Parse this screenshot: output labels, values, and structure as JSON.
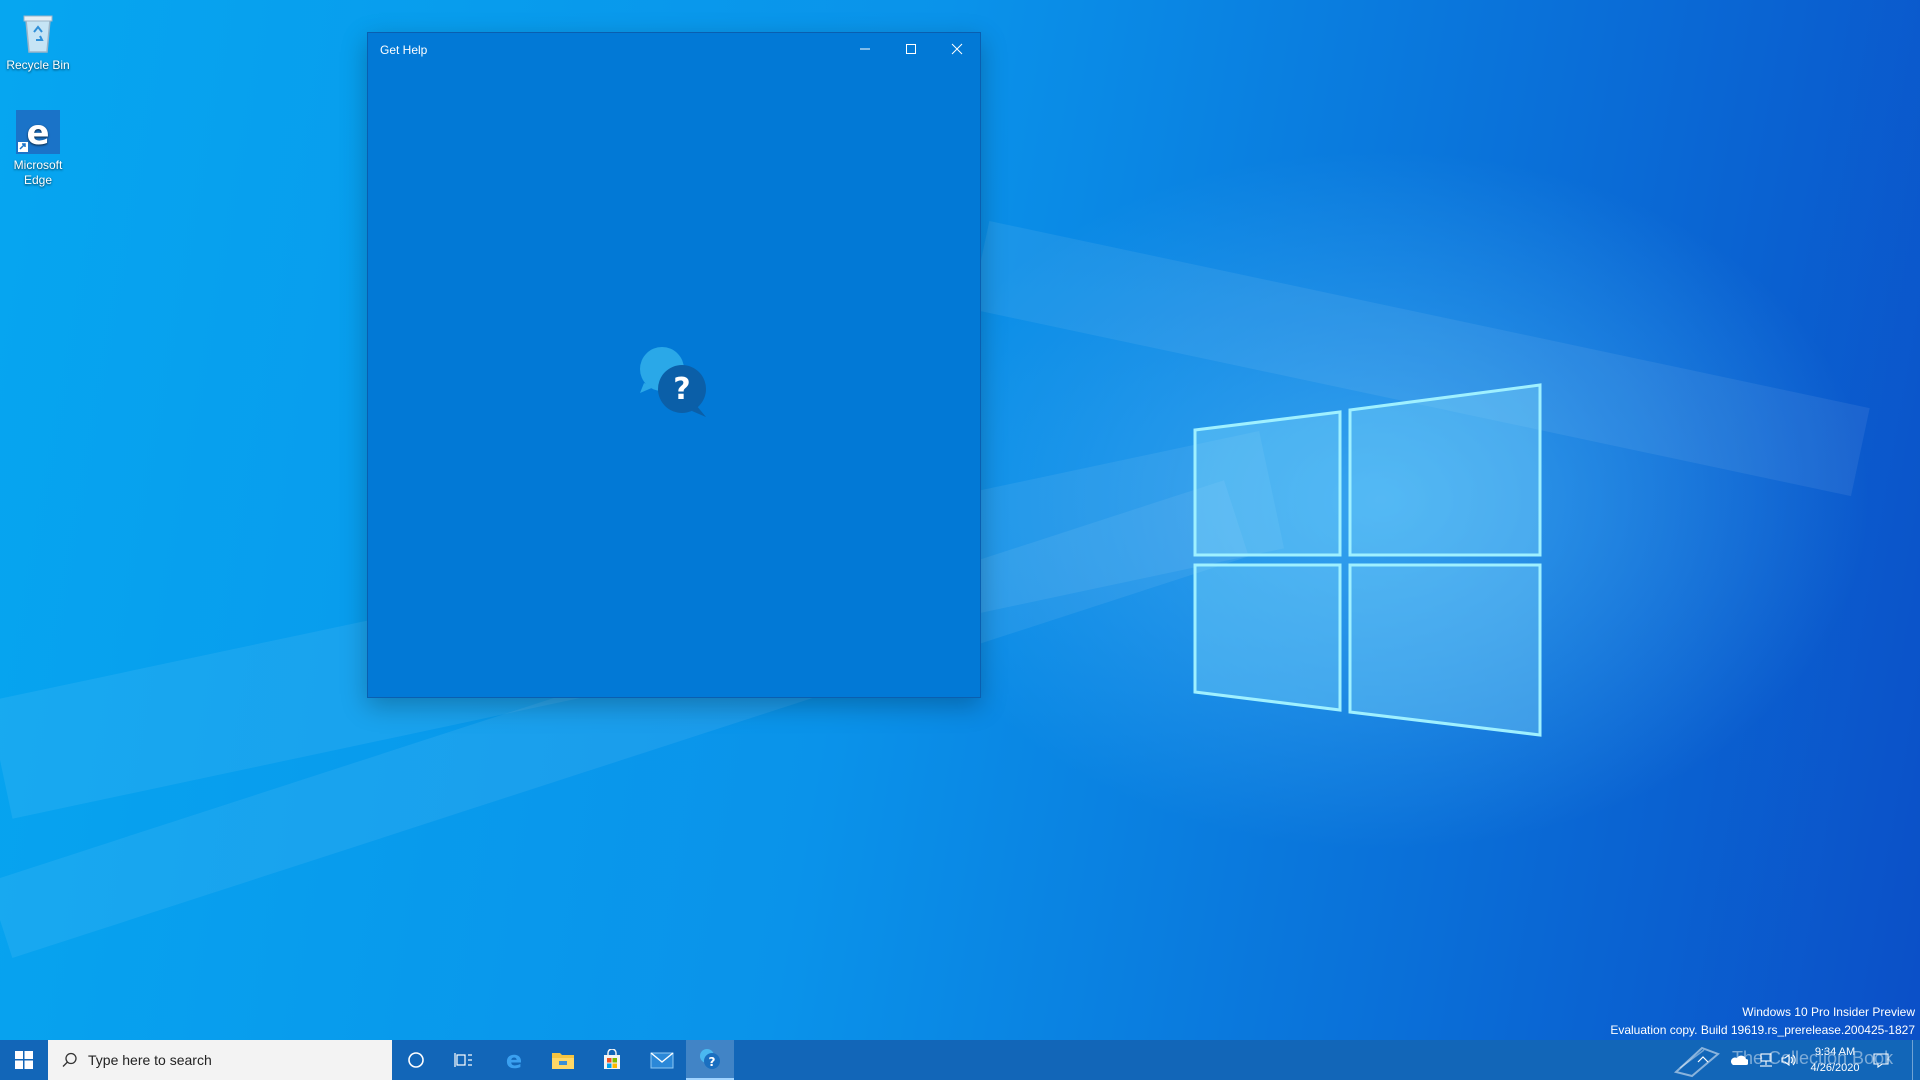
{
  "desktop": {
    "icons": [
      {
        "label": "Recycle Bin"
      },
      {
        "label": "Microsoft Edge"
      }
    ],
    "watermark": {
      "line1": "Windows 10 Pro Insider Preview",
      "line2": "Evaluation copy. Build 19619.rs_prerelease.200425-1827"
    },
    "overlay_text": "The Collection Book"
  },
  "window": {
    "title": "Get Help",
    "logo_icon": "get-help-icon",
    "controls": [
      "minimize-icon",
      "maximize-icon",
      "close-icon"
    ]
  },
  "taskbar": {
    "search_placeholder": "Type here to search",
    "apps": [
      {
        "icon": "cortana-icon"
      },
      {
        "icon": "task-view-icon"
      },
      {
        "icon": "edge-icon"
      },
      {
        "icon": "file-explorer-icon"
      },
      {
        "icon": "store-icon"
      },
      {
        "icon": "mail-icon"
      },
      {
        "icon": "get-help-icon",
        "active": true
      }
    ],
    "clock": {
      "time": "9:34 AM",
      "date": "4/26/2020"
    }
  },
  "colors": {
    "window_bg": "#0279d6",
    "taskbar_bg": "#1266b8",
    "accent": "#0a87e6"
  }
}
